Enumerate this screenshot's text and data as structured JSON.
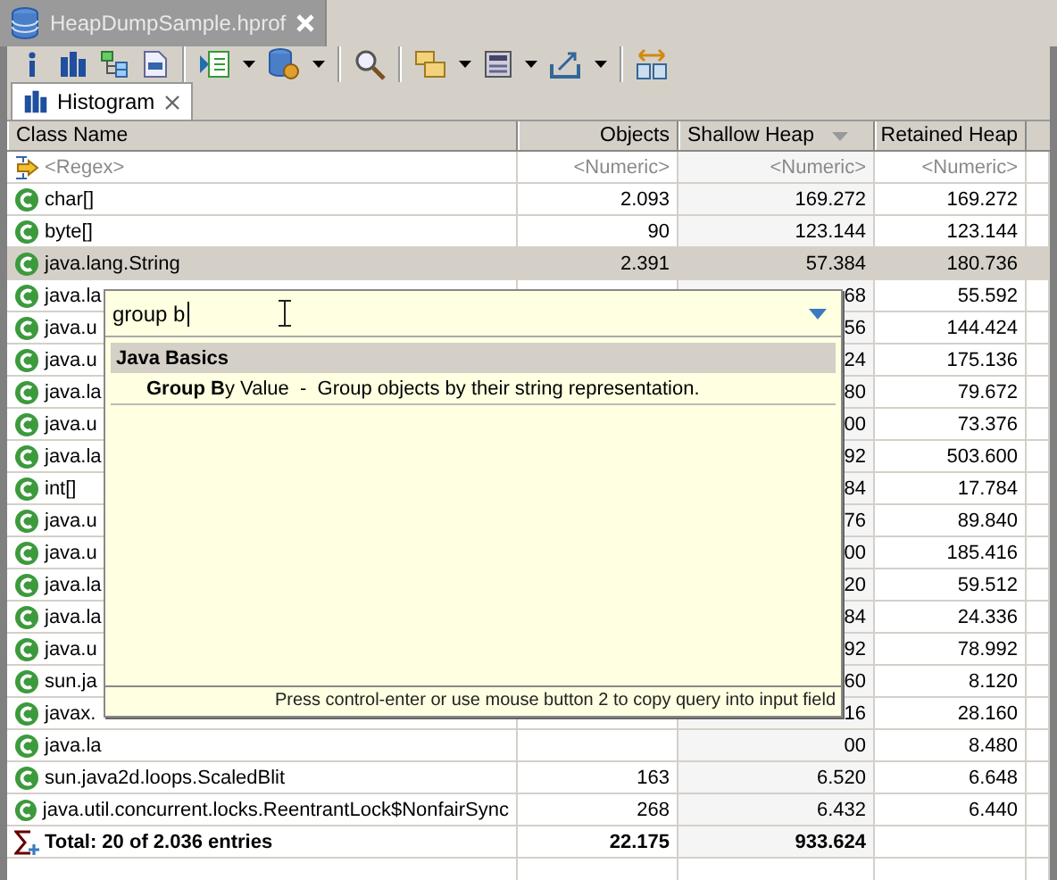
{
  "editor_tab": {
    "title": "HeapDumpSample.hprof",
    "selected": true
  },
  "view_tab": {
    "title": "Histogram",
    "selected": true
  },
  "table": {
    "columns": [
      {
        "label": "Class Name",
        "sorted": false
      },
      {
        "label": "Objects",
        "sorted": false
      },
      {
        "label": "Shallow Heap",
        "sorted": true
      },
      {
        "label": "Retained Heap",
        "sorted": false
      }
    ],
    "filter": [
      "<Regex>",
      "<Numeric>",
      "<Numeric>",
      "<Numeric>"
    ],
    "rows": [
      {
        "name": "char[]",
        "objects": "2.093",
        "shallow": "169.272",
        "retained": "169.272",
        "selected": false
      },
      {
        "name": "byte[]",
        "objects": "90",
        "shallow": "123.144",
        "retained": "123.144",
        "selected": false
      },
      {
        "name": "java.lang.String",
        "objects": "2.391",
        "shallow": "57.384",
        "retained": "180.736",
        "selected": true
      },
      {
        "name": "java.la",
        "objects": "",
        "shallow": "68",
        "retained": "55.592",
        "selected": false
      },
      {
        "name": "java.u",
        "objects": "",
        "shallow": "56",
        "retained": "144.424",
        "selected": false
      },
      {
        "name": "java.u",
        "objects": "",
        "shallow": "24",
        "retained": "175.136",
        "selected": false
      },
      {
        "name": "java.la",
        "objects": "",
        "shallow": "80",
        "retained": "79.672",
        "selected": false
      },
      {
        "name": "java.u",
        "objects": "",
        "shallow": "00",
        "retained": "73.376",
        "selected": false
      },
      {
        "name": "java.la",
        "objects": "",
        "shallow": "92",
        "retained": "503.600",
        "selected": false
      },
      {
        "name": "int[]",
        "objects": "",
        "shallow": "84",
        "retained": "17.784",
        "selected": false
      },
      {
        "name": "java.u",
        "objects": "",
        "shallow": "76",
        "retained": "89.840",
        "selected": false
      },
      {
        "name": "java.u",
        "objects": "",
        "shallow": "00",
        "retained": "185.416",
        "selected": false
      },
      {
        "name": "java.la",
        "objects": "",
        "shallow": "20",
        "retained": "59.512",
        "selected": false
      },
      {
        "name": "java.la",
        "objects": "",
        "shallow": "84",
        "retained": "24.336",
        "selected": false
      },
      {
        "name": "java.u",
        "objects": "",
        "shallow": "92",
        "retained": "78.992",
        "selected": false
      },
      {
        "name": "sun.ja",
        "objects": "",
        "shallow": "60",
        "retained": "8.120",
        "selected": false
      },
      {
        "name": "javax.",
        "objects": "",
        "shallow": "16",
        "retained": "28.160",
        "selected": false
      },
      {
        "name": "java.la",
        "objects": "",
        "shallow": "00",
        "retained": "8.480",
        "selected": false
      },
      {
        "name": "sun.java2d.loops.ScaledBlit",
        "objects": "163",
        "shallow": "6.520",
        "retained": "6.648",
        "selected": false
      },
      {
        "name": "java.util.concurrent.locks.ReentrantLock$NonfairSync",
        "objects": "268",
        "shallow": "6.432",
        "retained": "6.440",
        "selected": false
      }
    ],
    "total": {
      "label": "Total: 20 of 2.036 entries",
      "objects": "22.175",
      "shallow": "933.624"
    }
  },
  "query_popup": {
    "value": "group b",
    "categories": [
      {
        "title": "Java Basics",
        "items": [
          {
            "text": "**Group B**y Value  -  Group objects by their string representation."
          }
        ]
      }
    ],
    "hint": "Press control-enter or use mouse button 2 to copy query into input field"
  }
}
